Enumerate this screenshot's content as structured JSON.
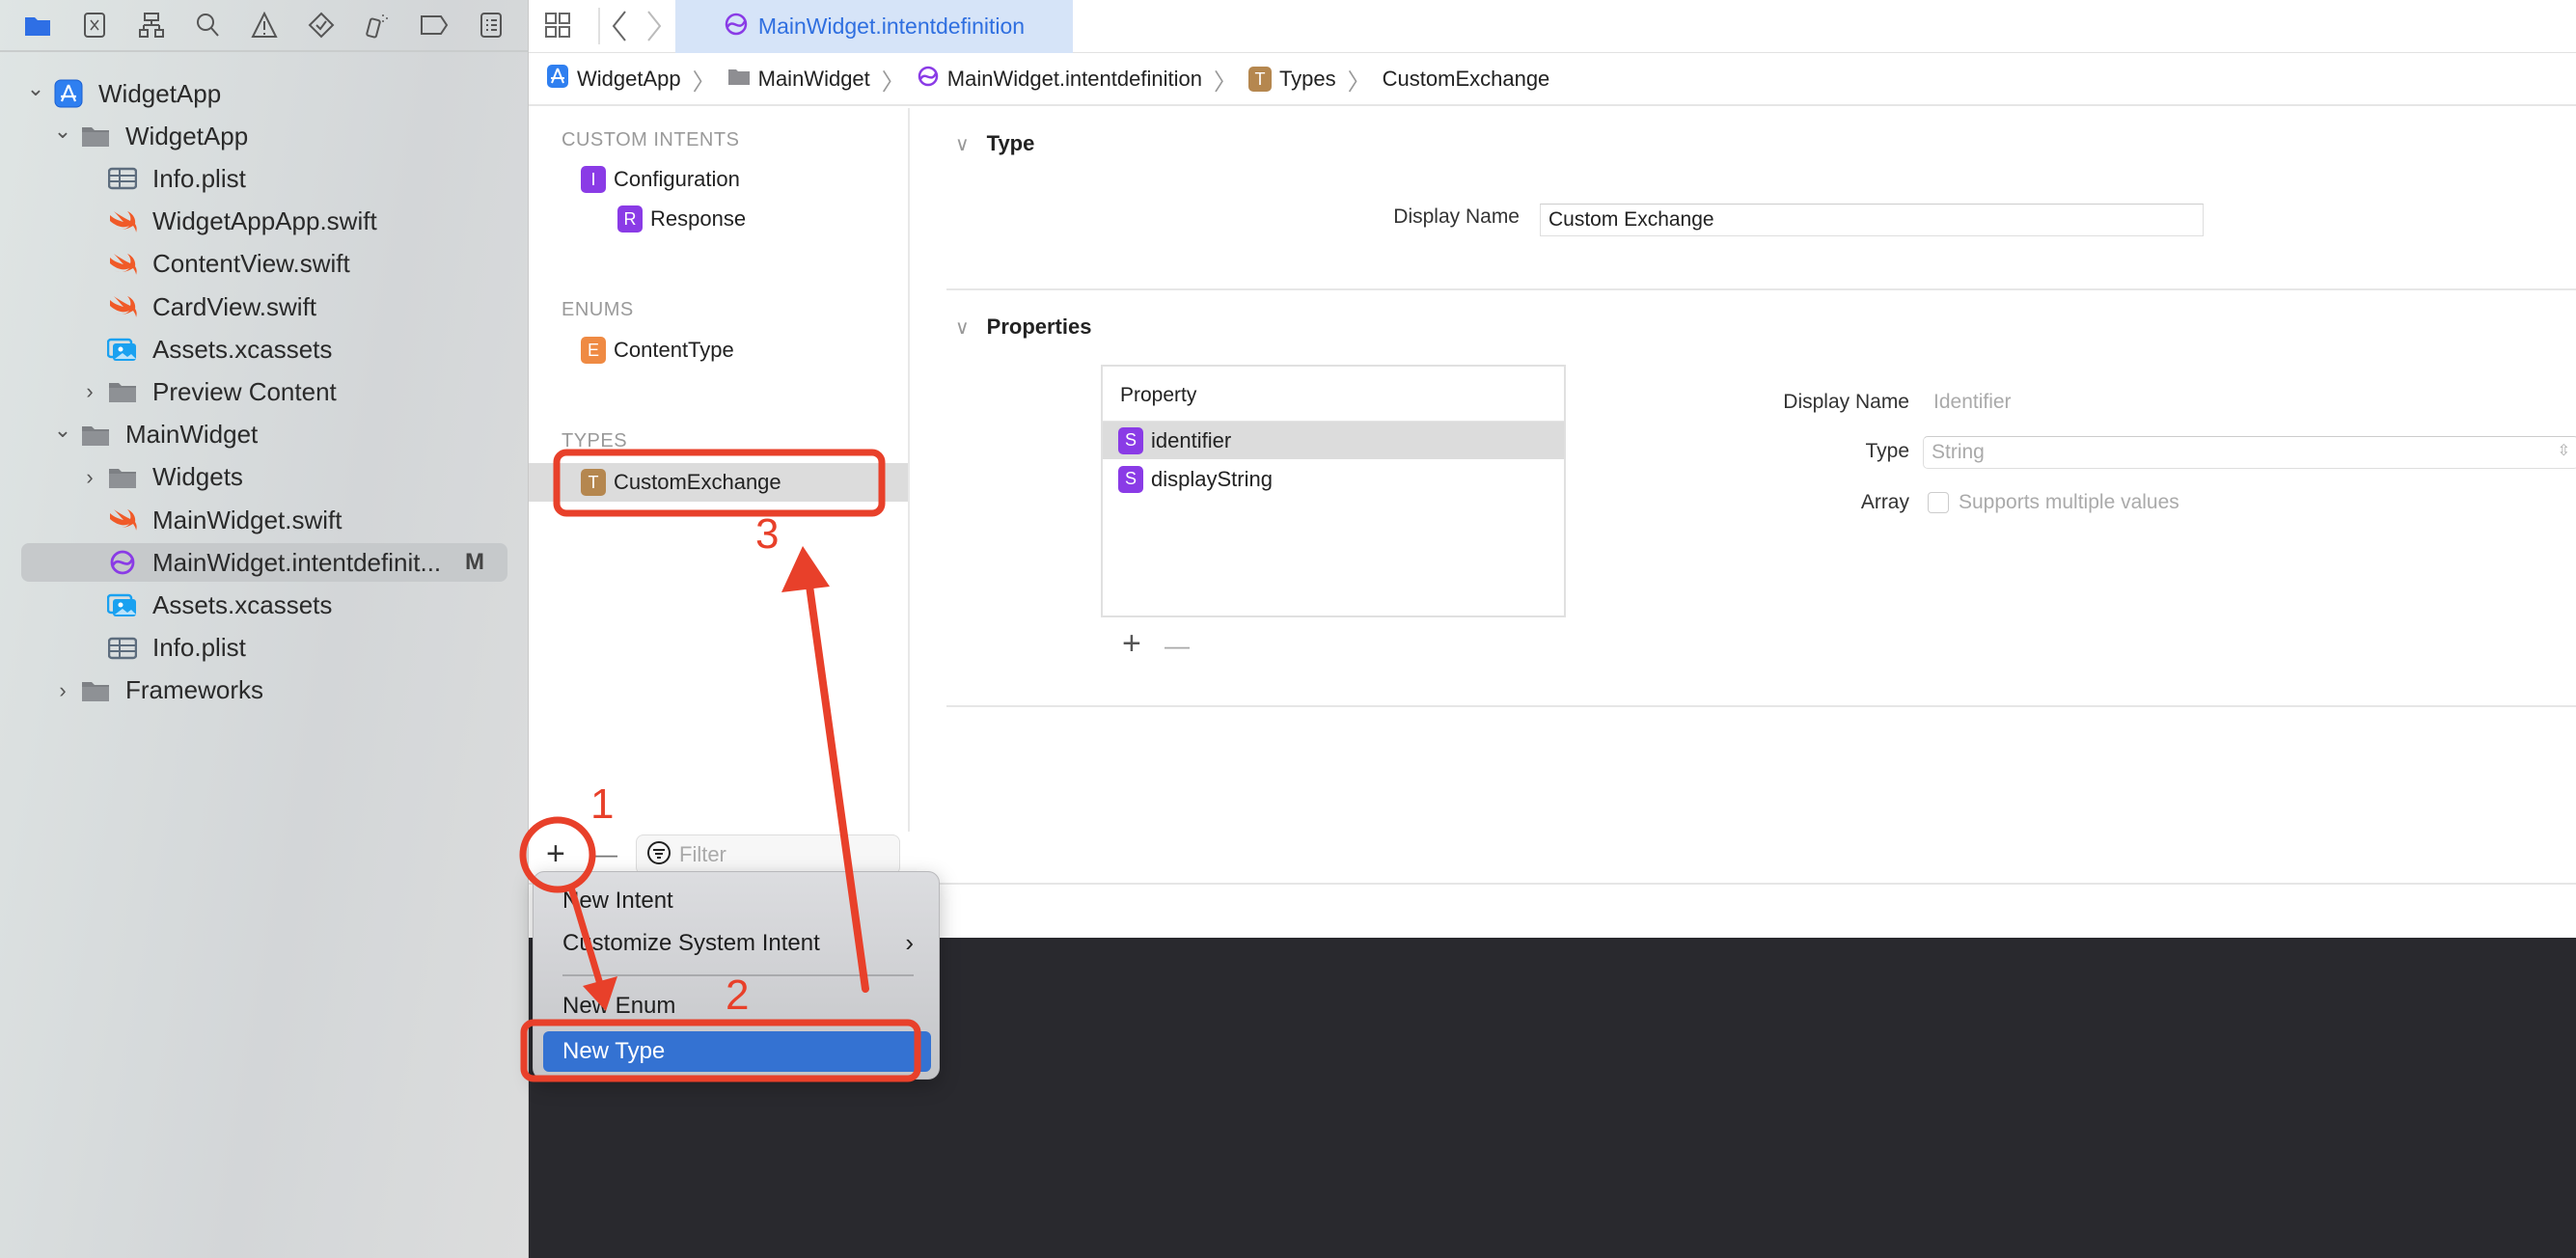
{
  "toolbar_icons": [
    "folder-icon",
    "source-control-icon",
    "hierarchy-icon",
    "search-icon",
    "warning-icon",
    "test-icon",
    "debug-icon",
    "breakpoint-icon",
    "report-icon"
  ],
  "tab": {
    "label": "MainWidget.intentdefinition"
  },
  "breadcrumb": [
    "WidgetApp",
    "MainWidget",
    "MainWidget.intentdefinition",
    "Types",
    "CustomExchange"
  ],
  "navigator": [
    {
      "label": "WidgetApp",
      "icon": "app-icon",
      "expanded": true
    },
    {
      "label": "WidgetApp",
      "icon": "folder-icon",
      "expanded": true
    },
    {
      "label": "Info.plist",
      "icon": "plist-icon"
    },
    {
      "label": "WidgetAppApp.swift",
      "icon": "swift-icon"
    },
    {
      "label": "ContentView.swift",
      "icon": "swift-icon"
    },
    {
      "label": "CardView.swift",
      "icon": "swift-icon"
    },
    {
      "label": "Assets.xcassets",
      "icon": "assets-icon"
    },
    {
      "label": "Preview Content",
      "icon": "folder-icon",
      "expanded": false
    },
    {
      "label": "MainWidget",
      "icon": "folder-icon",
      "expanded": true
    },
    {
      "label": "Widgets",
      "icon": "folder-icon",
      "expanded": false
    },
    {
      "label": "MainWidget.swift",
      "icon": "swift-icon"
    },
    {
      "label": "MainWidget.intentdefinit...",
      "icon": "intent-icon",
      "badge": "M",
      "selected": true
    },
    {
      "label": "Assets.xcassets",
      "icon": "assets-icon"
    },
    {
      "label": "Info.plist",
      "icon": "plist-icon"
    },
    {
      "label": "Frameworks",
      "icon": "folder-icon",
      "expanded": false
    }
  ],
  "intents": {
    "custom_intents_header": "CUSTOM INTENTS",
    "configuration": {
      "letter": "I",
      "label": "Configuration"
    },
    "response": {
      "letter": "R",
      "label": "Response"
    },
    "enums_header": "ENUMS",
    "content_type": {
      "letter": "E",
      "label": "ContentType"
    },
    "types_header": "TYPES",
    "custom_exchange": {
      "letter": "T",
      "label": "CustomExchange"
    },
    "filter_placeholder": "Filter",
    "add": "+",
    "remove": "—"
  },
  "editor": {
    "type_header": "Type",
    "display_name_label": "Display Name",
    "display_name_value": "Custom Exchange",
    "properties_header": "Properties",
    "property_column": "Property",
    "properties": [
      {
        "letter": "S",
        "label": "identifier",
        "selected": true
      },
      {
        "letter": "S",
        "label": "displayString"
      }
    ],
    "add": "+",
    "remove": "—",
    "prop_display_name_label": "Display Name",
    "prop_display_name_placeholder": "Identifier",
    "prop_type_label": "Type",
    "prop_type_value": "String",
    "prop_array_label": "Array",
    "prop_array_checkbox": "Supports multiple values",
    "prop_array_checked": false
  },
  "menu": {
    "items": [
      "New Intent",
      "Customize System Intent",
      "New Enum",
      "New Type"
    ],
    "highlighted": "New Type"
  },
  "annotations": {
    "step1": "1",
    "step2": "2",
    "step3": "3",
    "color": "#e8402a"
  },
  "colors": {
    "accent": "#2f6fe0",
    "tab_bg": "#d6e4f8",
    "menu_highlight": "#3472d2",
    "purple": "#8a3be6",
    "console": "#29292e"
  }
}
